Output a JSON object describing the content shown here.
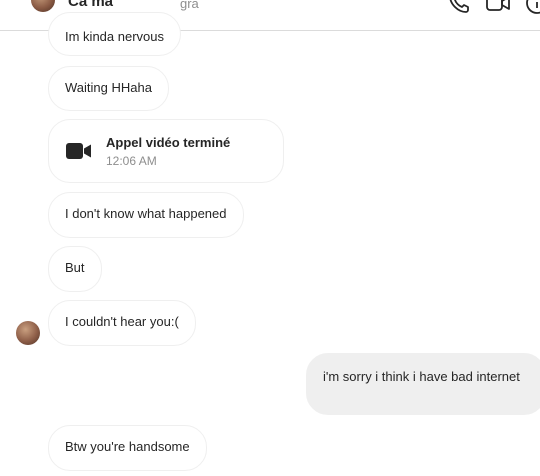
{
  "header": {
    "contact_name": "Ca  ma",
    "subtitle": "gra"
  },
  "messages": [
    {
      "text": "Im kinda nervous"
    },
    {
      "text": "Waiting HHaha"
    },
    {
      "text": "I don't know what happened"
    },
    {
      "text": "But"
    },
    {
      "text": "I couldn't hear you:("
    },
    {
      "text": "i'm sorry i think i have bad internet"
    },
    {
      "text": "Btw you're handsome"
    }
  ],
  "call": {
    "title": "Appel vidéo terminé",
    "time": "12:06 AM",
    "icon": "video-camera-icon"
  },
  "colors": {
    "border": "#efefef",
    "outgoing_bg": "#efefef",
    "text": "#262626",
    "muted": "#8e8e8e"
  }
}
